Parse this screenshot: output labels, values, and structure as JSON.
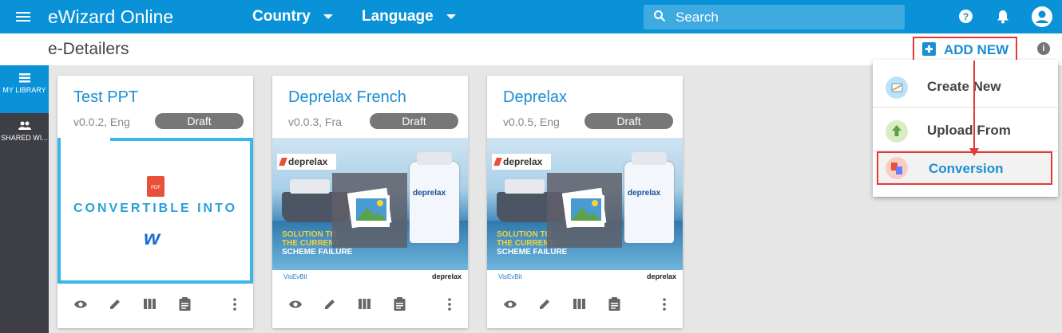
{
  "header": {
    "app_title": "eWizard Online",
    "country_label": "Country",
    "language_label": "Language",
    "search_placeholder": "Search"
  },
  "subheader": {
    "page_title": "e-Detailers",
    "add_new_label": "ADD NEW"
  },
  "sidebar": {
    "items": [
      {
        "label": "MY LIBRARY",
        "icon": "library-icon",
        "active": true
      },
      {
        "label": "SHARED WI...",
        "icon": "people-icon",
        "active": false
      }
    ]
  },
  "cards": [
    {
      "title": "Test PPT",
      "meta": "v0.0.2, Eng",
      "status": "Draft",
      "thumb_text": "CONVERTIBLE INTO",
      "thumb_badge": "PDF",
      "thumb_logo": "w"
    },
    {
      "title": "Deprelax French",
      "meta": "v0.0.3, Fra",
      "status": "Draft"
    },
    {
      "title": "Deprelax",
      "meta": "v0.0.5, Eng",
      "status": "Draft"
    }
  ],
  "deprelax_thumb": {
    "brand": "deprelax",
    "slogan_line1": "SOLUTION TO",
    "slogan_line2": "THE CURRENT",
    "slogan_line3": "SCHEME FAILURE",
    "bottle_label": "deprelax",
    "footer_left": "VisEvBit",
    "footer_right": "deprelax"
  },
  "menu": {
    "items": [
      {
        "label": "Create New",
        "icon": "create-new-icon",
        "color": "#bfe1f5"
      },
      {
        "label": "Upload From",
        "icon": "upload-icon",
        "color": "#d9ecc2"
      },
      {
        "label": "Conversion",
        "icon": "conversion-icon",
        "color": "#f6cfc4",
        "selected": true
      }
    ]
  },
  "colors": {
    "primary": "#0a92d8",
    "sidebar": "#3d3f45",
    "highlight": "#e53935",
    "badge": "#777777"
  }
}
